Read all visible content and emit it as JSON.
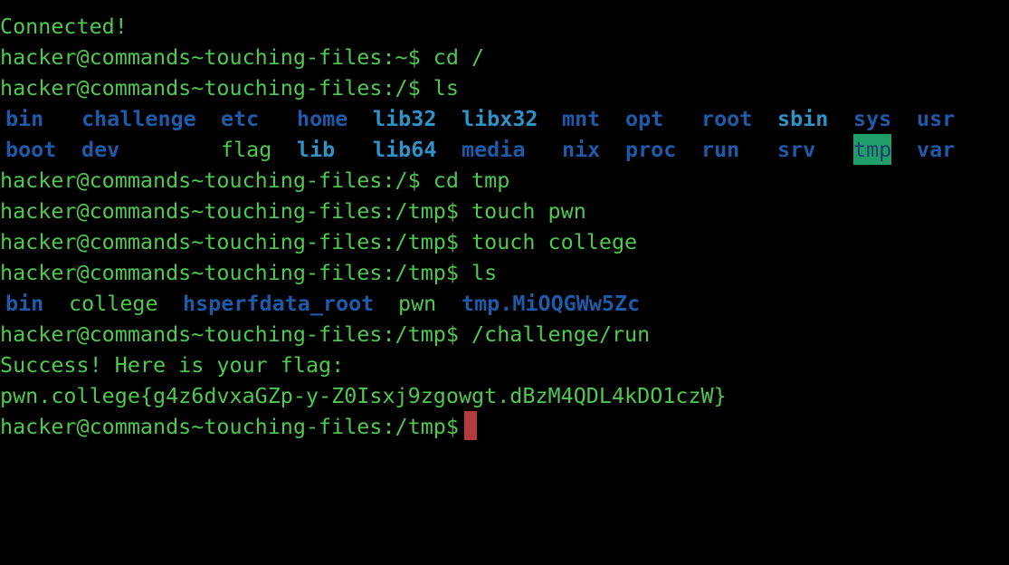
{
  "colors": {
    "background": "#000000",
    "text": "#4ec94e",
    "directory": "#1f5aa8",
    "symlink": "#2f93c8",
    "sticky_bg": "#1f9e6a",
    "cursor": "#b23a3a"
  },
  "terminal": {
    "connected": "Connected!",
    "prompt_home": "hacker@commands~touching-files:~$",
    "prompt_root": "hacker@commands~touching-files:/$",
    "prompt_tmp": "hacker@commands~touching-files:/tmp$",
    "cmd_cd_root": " cd /",
    "cmd_ls": " ls",
    "cmd_cd_tmp": " cd tmp",
    "cmd_touch_pwn": " touch pwn",
    "cmd_touch_college": " touch college",
    "cmd_run": " /challenge/run",
    "success": "Success! Here is your flag:",
    "flag": "pwn.college{g4z6dvxaGZp-y-Z0Isxj9zgowgt.dBzM4QDL4kDO1czW}",
    "ls_root_row1": [
      "bin",
      "challenge",
      "etc",
      "home",
      "lib32",
      "libx32",
      "mnt",
      "opt",
      "root",
      "sbin",
      "sys",
      "usr"
    ],
    "ls_root_row2": [
      "boot",
      "dev",
      "flag",
      "lib",
      "lib64",
      "media",
      "nix",
      "proc",
      "run",
      "srv",
      "tmp",
      "var"
    ],
    "ls_tmp": [
      "bin",
      "college",
      "hsperfdata_root",
      "pwn",
      "tmp.MiOQGWw5Zc"
    ]
  }
}
